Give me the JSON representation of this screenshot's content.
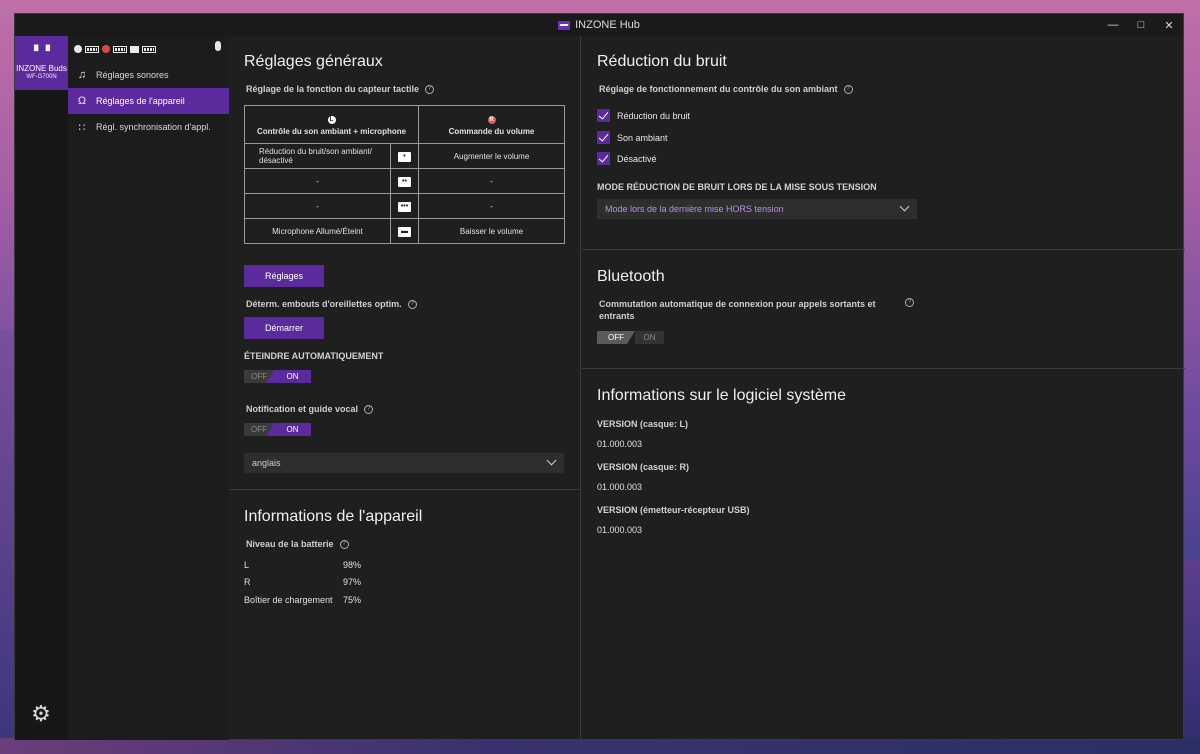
{
  "window": {
    "title": "INZONE Hub"
  },
  "rail": {
    "device_buds": "▘▝",
    "device_name": "INZONE Buds",
    "device_model": "WF-G700N"
  },
  "nav": {
    "items": [
      {
        "label": "Réglages sonores",
        "icon": "music-note-icon"
      },
      {
        "label": "Réglages de l'appareil",
        "icon": "headphones-icon"
      },
      {
        "label": "Régl. synchronisation d'appl.",
        "icon": "grid-icon"
      }
    ]
  },
  "general": {
    "title": "Réglages généraux",
    "touch_label": "Réglage de la fonction du capteur tactile",
    "table": {
      "left_header": "Contrôle du son ambiant + microphone",
      "left_ear": "L",
      "right_header": "Commande du volume",
      "right_ear": "R",
      "rows": [
        {
          "left": "Réduction du bruit/son ambiant/ désactivé",
          "taps": "•",
          "right": "Augmenter le volume"
        },
        {
          "left": "-",
          "taps": "••",
          "right": "-"
        },
        {
          "left": "-",
          "taps": "•••",
          "right": "-"
        },
        {
          "left": "Microphone Allumé/Éteint",
          "taps": "▬",
          "right": "Baisser le volume"
        }
      ]
    },
    "settings_button": "Réglages",
    "eartip_label": "Déterm. embouts d'oreillettes optim.",
    "start_button": "Démarrer",
    "auto_off_label": "ÉTEINDRE AUTOMATIQUEMENT",
    "auto_off": {
      "off": "OFF",
      "on": "ON"
    },
    "voice_label": "Notification et guide vocal",
    "voice": {
      "off": "OFF",
      "on": "ON"
    },
    "language": "anglais"
  },
  "device_info": {
    "title": "Informations de l'appareil",
    "battery_label": "Niveau de la batterie",
    "battery": [
      {
        "label": "L",
        "value": "98%"
      },
      {
        "label": "R",
        "value": "97%"
      },
      {
        "label": "Boîtier de chargement",
        "value": "75%"
      }
    ]
  },
  "noise": {
    "title": "Réduction du bruit",
    "label": "Réglage de fonctionnement du contrôle du son ambiant",
    "options": [
      "Réduction du bruit",
      "Son ambiant",
      "Désactivé"
    ],
    "power_on_label": "MODE RÉDUCTION DE BRUIT LORS DE LA MISE SOUS TENSION",
    "power_on_value": "Mode lors de la dernière mise HORS tension"
  },
  "bluetooth": {
    "title": "Bluetooth",
    "label": "Commutation automatique de connexion pour appels sortants et entrants",
    "toggle": {
      "off": "OFF",
      "on": "ON"
    }
  },
  "software": {
    "title": "Informations sur le logiciel système",
    "versions": [
      {
        "label": "VERSION (casque: L)",
        "value": "01.000.003"
      },
      {
        "label": "VERSION (casque: R)",
        "value": "01.000.003"
      },
      {
        "label": "VERSION (émetteur-récepteur USB)",
        "value": "01.000.003"
      }
    ]
  },
  "colors": {
    "accent": "#5b2a9d",
    "background": "#1f1f1f"
  }
}
